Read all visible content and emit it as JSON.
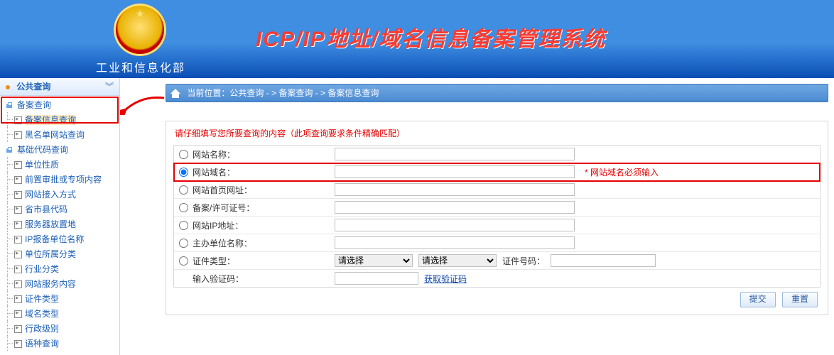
{
  "header": {
    "ministry": "工业和信息化部",
    "title": "ICP/IP地址/域名信息备案管理系统"
  },
  "sidebar": {
    "group_label": "公共查询",
    "nodes": [
      {
        "label": "备案查询",
        "kind": "top"
      },
      {
        "label": "备案信息查询",
        "kind": "sub",
        "selected": true
      },
      {
        "label": "黑名单网站查询",
        "kind": "sub"
      },
      {
        "label": "基础代码查询",
        "kind": "top"
      },
      {
        "label": "单位性质",
        "kind": "sub"
      },
      {
        "label": "前置审批或专项内容",
        "kind": "sub"
      },
      {
        "label": "网站接入方式",
        "kind": "sub"
      },
      {
        "label": "省市县代码",
        "kind": "sub"
      },
      {
        "label": "服务器放置地",
        "kind": "sub"
      },
      {
        "label": "IP报备单位名称",
        "kind": "sub"
      },
      {
        "label": "单位所属分类",
        "kind": "sub"
      },
      {
        "label": "行业分类",
        "kind": "sub"
      },
      {
        "label": "网站服务内容",
        "kind": "sub"
      },
      {
        "label": "证件类型",
        "kind": "sub"
      },
      {
        "label": "域名类型",
        "kind": "sub"
      },
      {
        "label": "行政级别",
        "kind": "sub"
      },
      {
        "label": "语种查询",
        "kind": "sub"
      }
    ]
  },
  "breadcrumb": {
    "label_prefix": "当前位置：",
    "items": [
      "公共查询",
      "备案查询",
      "备案信息查询"
    ],
    "sep": "  -  > "
  },
  "form": {
    "title": "请仔细填写您所要查询的内容（此项查询要求条件精确匹配）",
    "rows": [
      {
        "label": "网站名称：",
        "type": "text",
        "checked": false
      },
      {
        "label": "网站域名：",
        "type": "text",
        "checked": true,
        "highlight": true,
        "required_msg": "* 网站域名必须输入"
      },
      {
        "label": "网站首页网址：",
        "type": "text",
        "checked": false
      },
      {
        "label": "备案/许可证号：",
        "type": "text",
        "checked": false
      },
      {
        "label": "网站IP地址：",
        "type": "text",
        "checked": false
      },
      {
        "label": "主办单位名称：",
        "type": "text",
        "checked": false
      },
      {
        "label": "证件类型：",
        "type": "doc",
        "checked": false,
        "select_placeholder": "请选择",
        "id_label": "证件号码："
      },
      {
        "label": "输入验证码：",
        "type": "captcha",
        "link": "获取验证码"
      }
    ],
    "buttons": {
      "submit": "提交",
      "reset": "重置"
    }
  }
}
